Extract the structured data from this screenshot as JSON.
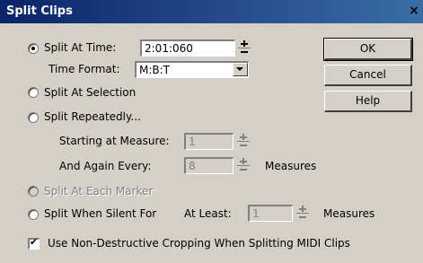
{
  "window": {
    "title": "Split Clips",
    "close_glyph": "×"
  },
  "options": {
    "split_at_time": {
      "label": "Split At Time:",
      "value": "2:01:060",
      "selected": true
    },
    "time_format": {
      "label": "Time Format:",
      "value": "M:B:T"
    },
    "split_at_selection": {
      "label": "Split At Selection",
      "selected": false
    },
    "split_repeatedly": {
      "label": "Split Repeatedly...",
      "selected": false
    },
    "starting_at_measure": {
      "label": "Starting at Measure:",
      "value": "1"
    },
    "and_again_every": {
      "label": "And Again Every:",
      "value": "8",
      "unit": "Measures"
    },
    "split_at_each_marker": {
      "label": "Split At Each Marker",
      "selected": false,
      "enabled": false
    },
    "split_when_silent": {
      "label": "Split When Silent For",
      "at_least_label": "At Least:",
      "value": "1",
      "unit": "Measures",
      "selected": false
    }
  },
  "buttons": {
    "ok": "OK",
    "cancel": "Cancel",
    "help": "Help"
  },
  "checkbox": {
    "label": "Use Non-Destructive Cropping When Splitting MIDI Clips",
    "checked": true
  },
  "icons": {
    "checkmark": "✔",
    "dropdown": "chevron-down",
    "spinner": "up-down-spinner"
  }
}
